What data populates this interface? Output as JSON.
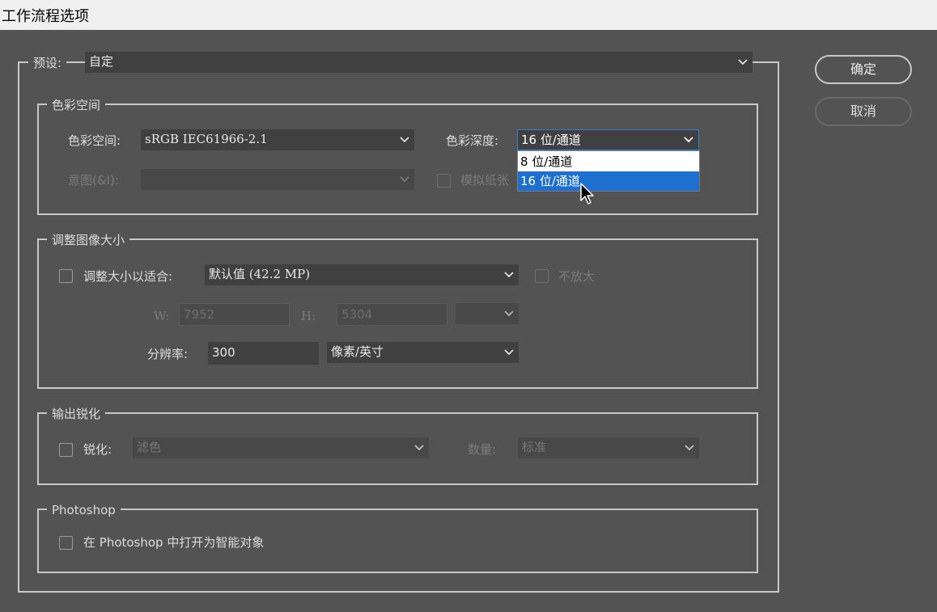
{
  "window": {
    "title": "工作流程选项"
  },
  "preset": {
    "label": "预设:",
    "value": "自定"
  },
  "buttons": {
    "ok": "确定",
    "cancel": "取消"
  },
  "color_space": {
    "title": "色彩空间",
    "space_label": "色彩空间:",
    "space_value": "sRGB IEC61966-2.1",
    "depth_label": "色彩深度:",
    "depth_value": "16 位/通道",
    "depth_options": [
      "8 位/通道",
      "16 位/通道"
    ],
    "intent_label": "意图(&I):",
    "simulate_label": "模拟纸张"
  },
  "resize": {
    "title": "调整图像大小",
    "fit_label": "调整大小以适合:",
    "fit_value": "默认值 (42.2 MP)",
    "no_enlarge_label": "不放大",
    "w_label": "W:",
    "w_value": "7952",
    "h_label": "H:",
    "h_value": "5304",
    "resolution_label": "分辨率:",
    "resolution_value": "300",
    "resolution_unit": "像素/英寸"
  },
  "sharpen": {
    "title": "输出锐化",
    "sharpen_label": "锐化:",
    "sharpen_value": "滤色",
    "amount_label": "数量:",
    "amount_value": "标准"
  },
  "photoshop": {
    "title": "Photoshop",
    "smart_object_label": "在 Photoshop 中打开为智能对象"
  },
  "icons": {
    "dropdown": "chevron-down-icon",
    "cursor": "mouse-pointer-icon"
  },
  "colors": {
    "background": "#535353",
    "field": "#404040",
    "highlight": "#1e6fd0"
  }
}
